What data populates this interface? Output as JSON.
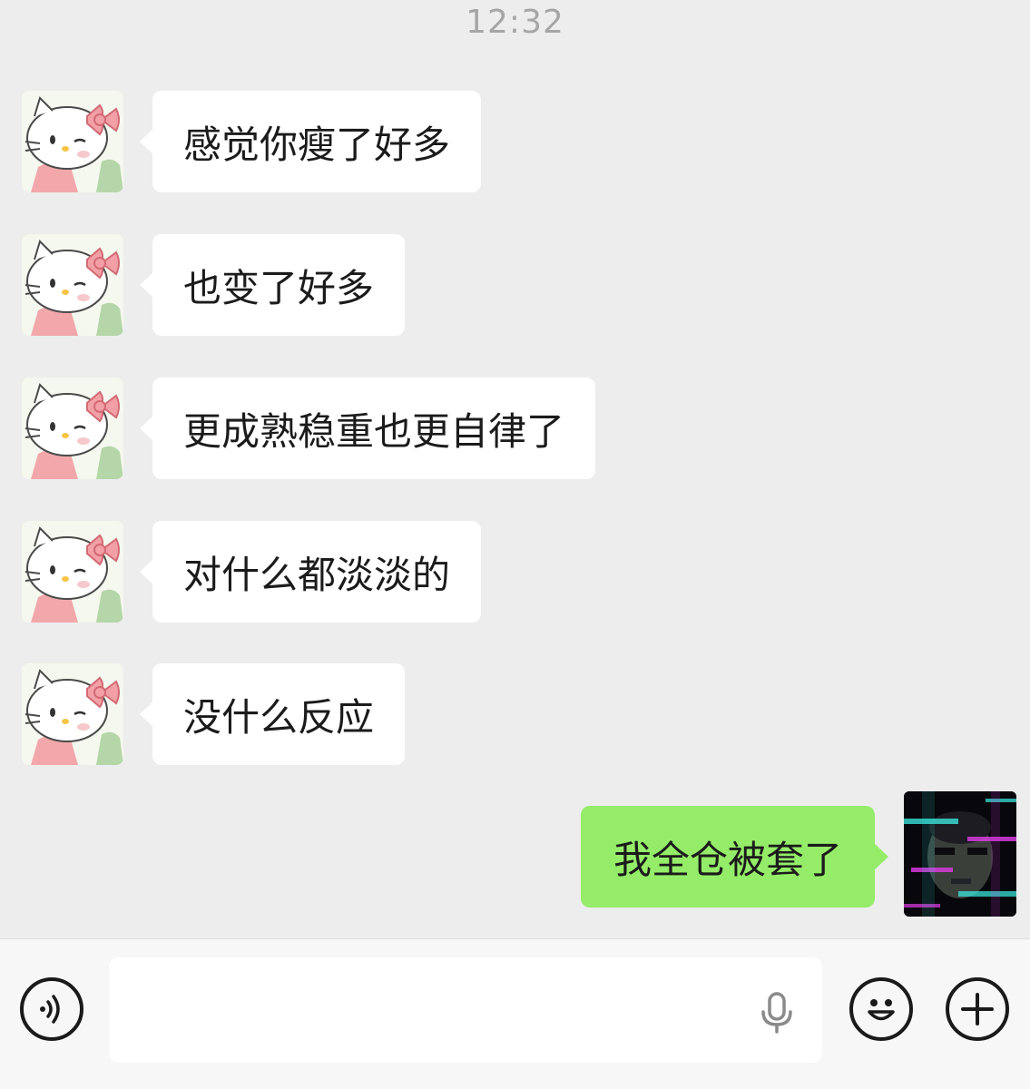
{
  "status": {
    "time": "12:32"
  },
  "messages": [
    {
      "direction": "incoming",
      "text": "感觉你瘦了好多"
    },
    {
      "direction": "incoming",
      "text": "也变了好多"
    },
    {
      "direction": "incoming",
      "text": "更成熟稳重也更自律了"
    },
    {
      "direction": "incoming",
      "text": "对什么都淡淡的"
    },
    {
      "direction": "incoming",
      "text": "没什么反应"
    },
    {
      "direction": "outgoing",
      "text": "我全仓被套了"
    }
  ],
  "input_bar": {
    "text_value": "",
    "icons": [
      "voice-mode-icon",
      "microphone-icon",
      "emoji-icon",
      "plus-icon"
    ]
  },
  "colors": {
    "background": "#ededed",
    "incoming_bubble": "#ffffff",
    "outgoing_bubble": "#95ec69",
    "timestamp": "#a6a6a6"
  }
}
